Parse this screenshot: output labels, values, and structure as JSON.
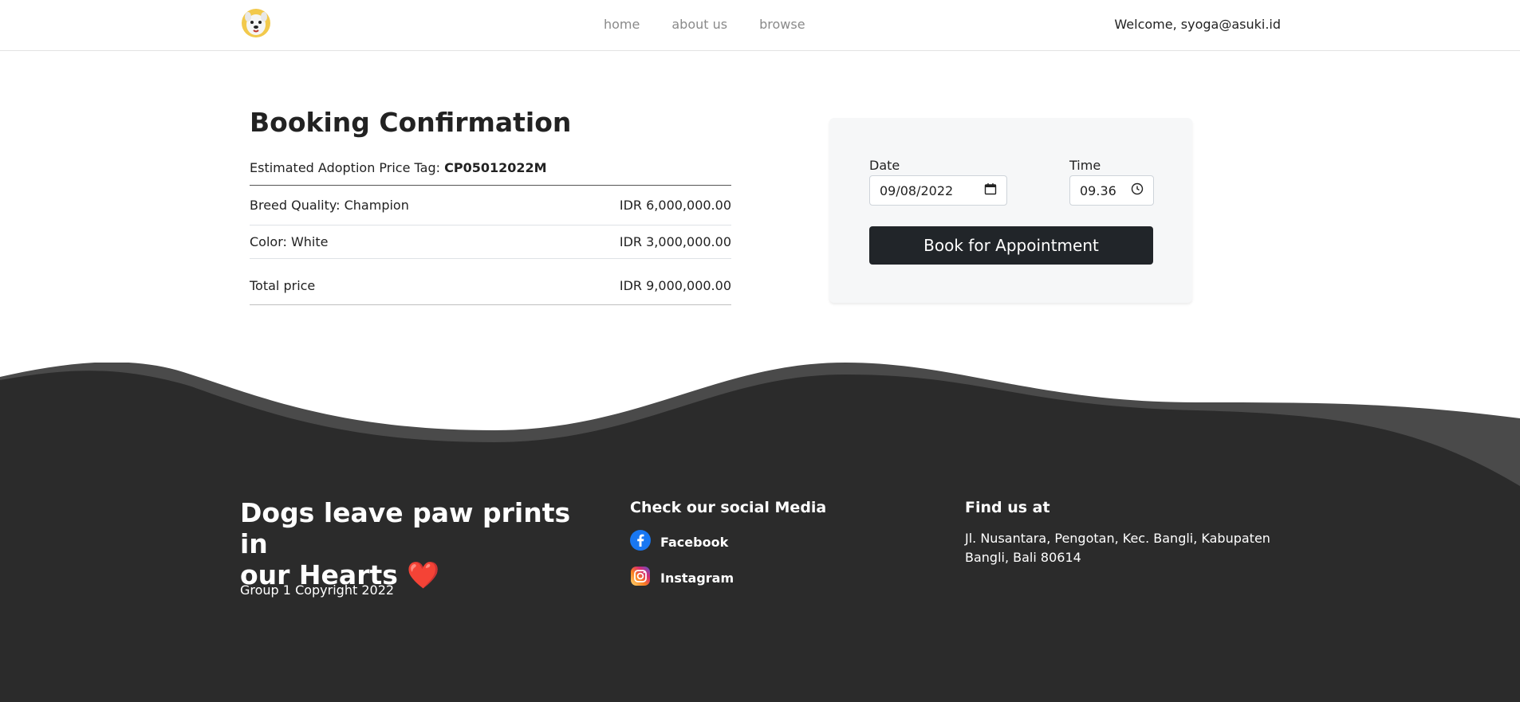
{
  "nav": {
    "links": [
      "home",
      "about us",
      "browse"
    ],
    "welcome": "Welcome, syoga@asuki.id"
  },
  "booking": {
    "title": "Booking Confirmation",
    "price_tag_label": "Estimated Adoption Price Tag:",
    "price_tag_code": "CP05012022M",
    "rows": [
      {
        "label": "Breed Quality: Champion",
        "value": "IDR 6,000,000.00"
      },
      {
        "label": "Color: White",
        "value": "IDR 3,000,000.00"
      }
    ],
    "total_label": "Total price",
    "total_value": "IDR 9,000,000.00"
  },
  "form": {
    "date_label": "Date",
    "date_value": "09/08/2022",
    "time_label": "Time",
    "time_value": "09.36",
    "submit_label": "Book for Appointment"
  },
  "footer": {
    "heading_line1": "Dogs leave paw prints in",
    "heading_line2": "our Hearts",
    "heart": "❤️",
    "copyright": "Group 1 Copyright 2022",
    "social_title": "Check our social Media",
    "facebook": "Facebook",
    "instagram": "Instagram",
    "find_title": "Find us at",
    "address": "Jl. Nusantara, Pengotan, Kec. Bangli, Kabupaten Bangli, Bali 80614"
  },
  "colors": {
    "footer_bg": "#2b2b2b",
    "wave_light": "#4a4a4a",
    "button_bg": "#212529",
    "card_bg": "#f6f7f8"
  },
  "icons": [
    "dog-logo-icon",
    "calendar-icon",
    "clock-icon",
    "facebook-icon",
    "instagram-icon"
  ]
}
